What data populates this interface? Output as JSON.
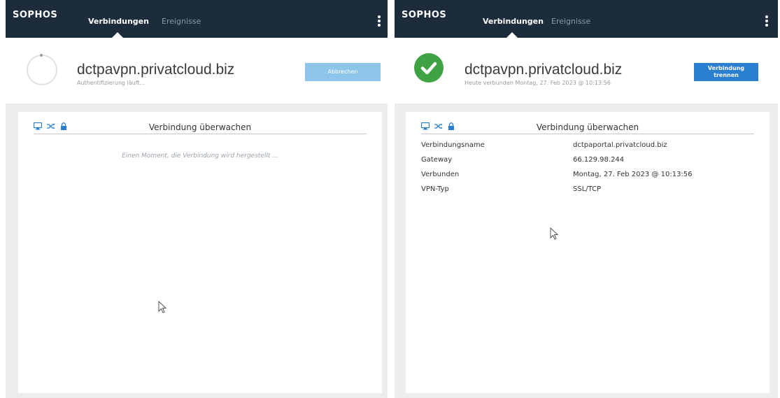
{
  "left_window": {
    "brand": "SOPHOS",
    "tabs": [
      {
        "label": "Verbindungen",
        "active": true
      },
      {
        "label": "Ereignisse",
        "active": false
      }
    ],
    "connection": {
      "title": "dctpavpn.privatcloud.biz",
      "status": "Authentifizierung läuft...",
      "button_label": "Abbrechen"
    },
    "panel": {
      "title": "Verbindung überwachen",
      "message": "Einen Moment, die Verbindung wird hergestellt ..."
    }
  },
  "right_window": {
    "brand": "SOPHOS",
    "tabs": [
      {
        "label": "Verbindungen",
        "active": true
      },
      {
        "label": "Ereignisse",
        "active": false
      }
    ],
    "connection": {
      "title": "dctpavpn.privatcloud.biz",
      "status": "Heute verbunden Montag, 27. Feb 2023 @ 10:13:56",
      "button_label_line1": "Verbindung",
      "button_label_line2": "trennen"
    },
    "panel": {
      "title": "Verbindung überwachen",
      "details": [
        {
          "key": "Verbindungsname",
          "value": "dctpaportal.privatcloud.biz"
        },
        {
          "key": "Gateway",
          "value": "66.129.98.244"
        },
        {
          "key": "Verbunden",
          "value": "Montag, 27. Feb 2023 @ 10:13:56"
        },
        {
          "key": "VPN-Typ",
          "value": "SSL/TCP"
        }
      ]
    }
  },
  "colors": {
    "topbar": "#1c2c3c",
    "accent_blue": "#2a7fd0",
    "cancel_disabled": "#8ec5ea",
    "success_green": "#3fa344",
    "background": "#ececec"
  },
  "icons": [
    "monitor-icon",
    "shuffle-icon",
    "lock-icon",
    "spinner-icon",
    "check-circle-icon",
    "kebab-menu-icon",
    "cursor-icon"
  ]
}
